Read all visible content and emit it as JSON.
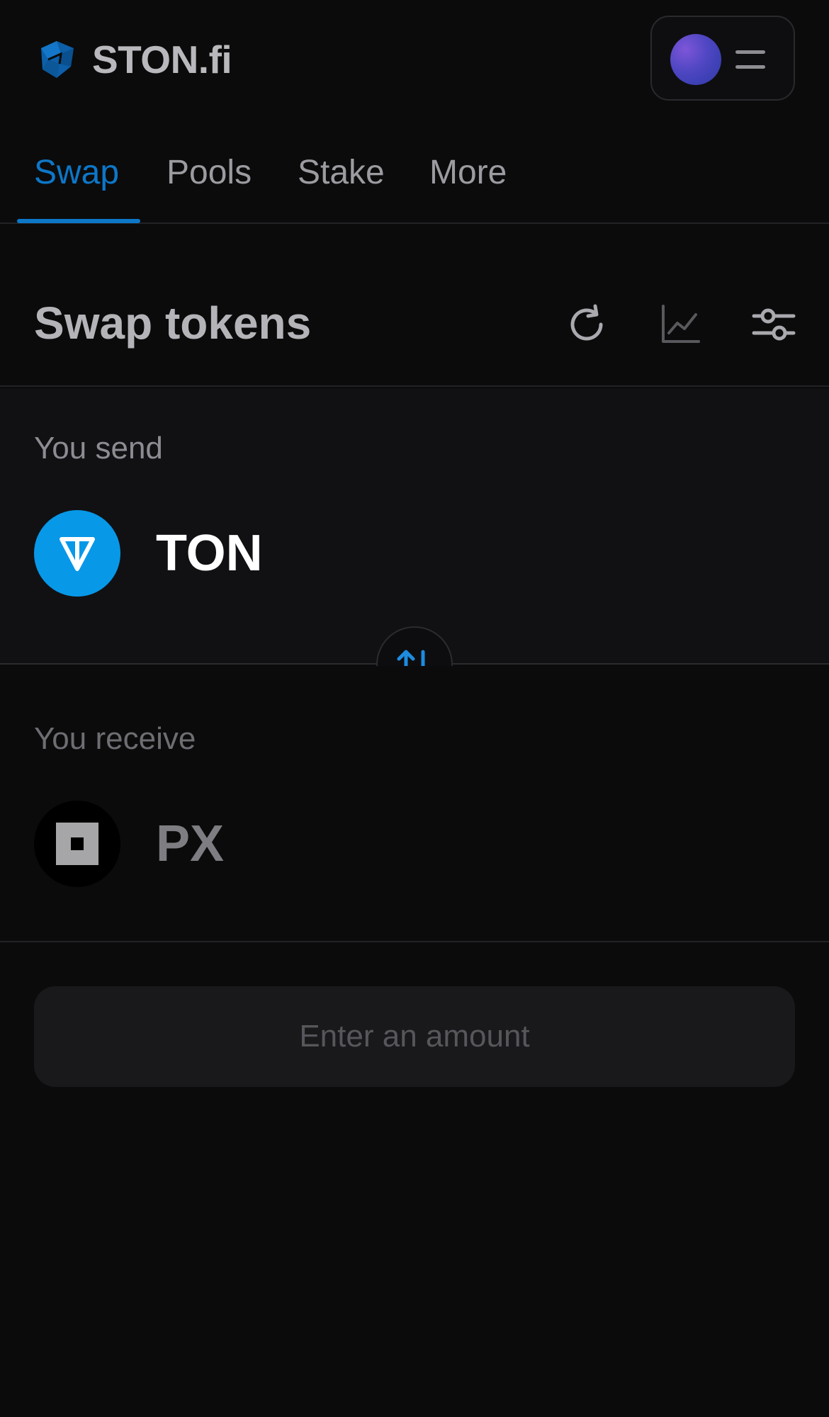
{
  "header": {
    "logo_text": "STON.fi",
    "logo_icon": "ston-logo-icon",
    "wallet_avatar": "avatar",
    "menu_icon": "hamburger-menu-icon"
  },
  "tabs": [
    {
      "label": "Swap",
      "active": true
    },
    {
      "label": "Pools",
      "active": false
    },
    {
      "label": "Stake",
      "active": false
    },
    {
      "label": "More",
      "active": false
    }
  ],
  "swap": {
    "title": "Swap tokens",
    "icons": [
      "refresh-icon",
      "chart-icon",
      "settings-sliders-icon"
    ]
  },
  "send": {
    "label": "You send",
    "token": "TON",
    "token_icon": "ton-token-icon"
  },
  "receive": {
    "label": "You receive",
    "token": "PX",
    "token_icon": "px-token-icon"
  },
  "switch_icon": "swap-arrows-icon",
  "action": {
    "label": "Enter an amount"
  },
  "colors": {
    "background": "#0b0b0c",
    "accent": "#0d77c8",
    "ton_blue": "#0898e8",
    "card": "#111114",
    "button": "#19191b"
  }
}
